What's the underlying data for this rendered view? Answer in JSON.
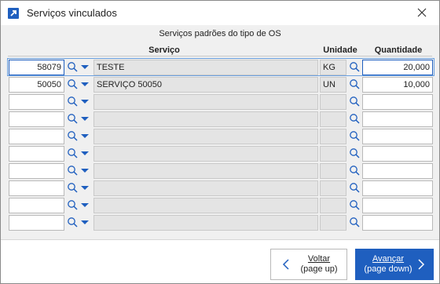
{
  "window": {
    "title": "Serviços vinculados"
  },
  "caption": "Serviços padrões do tipo de OS",
  "columns": {
    "servico": "Serviço",
    "unidade": "Unidade",
    "quantidade": "Quantidade"
  },
  "rows": [
    {
      "code": "58079",
      "desc": "TESTE",
      "unit": "KG",
      "qty": "20,000"
    },
    {
      "code": "50050",
      "desc": "SERVIÇO 50050",
      "unit": "UN",
      "qty": "10,000"
    },
    {
      "code": "",
      "desc": "",
      "unit": "",
      "qty": ""
    },
    {
      "code": "",
      "desc": "",
      "unit": "",
      "qty": ""
    },
    {
      "code": "",
      "desc": "",
      "unit": "",
      "qty": ""
    },
    {
      "code": "",
      "desc": "",
      "unit": "",
      "qty": ""
    },
    {
      "code": "",
      "desc": "",
      "unit": "",
      "qty": ""
    },
    {
      "code": "",
      "desc": "",
      "unit": "",
      "qty": ""
    },
    {
      "code": "",
      "desc": "",
      "unit": "",
      "qty": ""
    },
    {
      "code": "",
      "desc": "",
      "unit": "",
      "qty": ""
    }
  ],
  "buttons": {
    "back": {
      "line1": "Voltar",
      "line2": "(page up)"
    },
    "next": {
      "line1": "Avançar",
      "line2": "(page down)"
    }
  },
  "icons": {
    "app": "app-icon",
    "close": "close-icon",
    "search": "search-icon",
    "dropdown": "dropdown-icon",
    "back": "chevron-left-icon",
    "next": "chevron-right-icon"
  },
  "colors": {
    "accent": "#1f5fbf",
    "readonly": "#e4e4e4",
    "background": "#f0f0f0"
  }
}
